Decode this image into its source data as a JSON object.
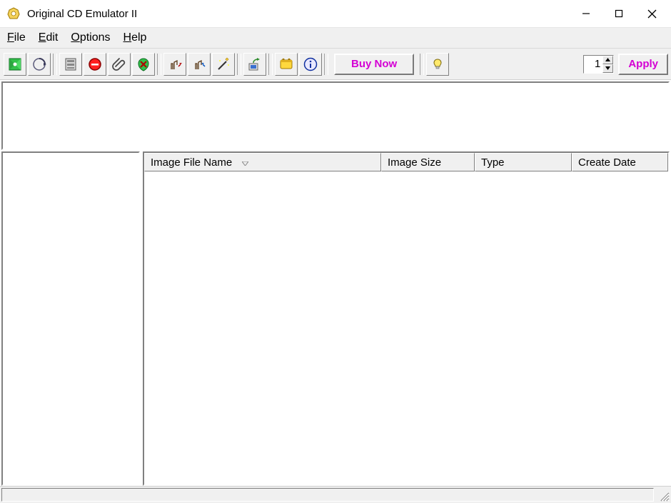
{
  "window": {
    "title": "Original CD Emulator II"
  },
  "menu": {
    "file": "File",
    "edit": "Edit",
    "options": "Options",
    "help": "Help"
  },
  "toolbar": {
    "buy_label": "Buy Now",
    "apply_label": "Apply",
    "spin_value": "1",
    "icons": {
      "create_image": "create-image-icon",
      "refresh": "refresh-icon",
      "drive_settings": "drive-settings-icon",
      "eject": "eject-icon",
      "attach": "attach-icon",
      "delete": "delete-icon",
      "mount_hand": "mount-hand-icon",
      "unmount_hand": "unmount-hand-icon",
      "wizard": "wizard-icon",
      "share": "share-icon",
      "favorites": "favorites-icon",
      "info": "info-icon",
      "hint": "hint-icon"
    }
  },
  "columns": {
    "c0": "Image File Name",
    "c1": "Image Size",
    "c2": "Type",
    "c3": "Create Date"
  },
  "statusbar": {
    "text": ""
  },
  "colors": {
    "accent": "#d400d4"
  }
}
